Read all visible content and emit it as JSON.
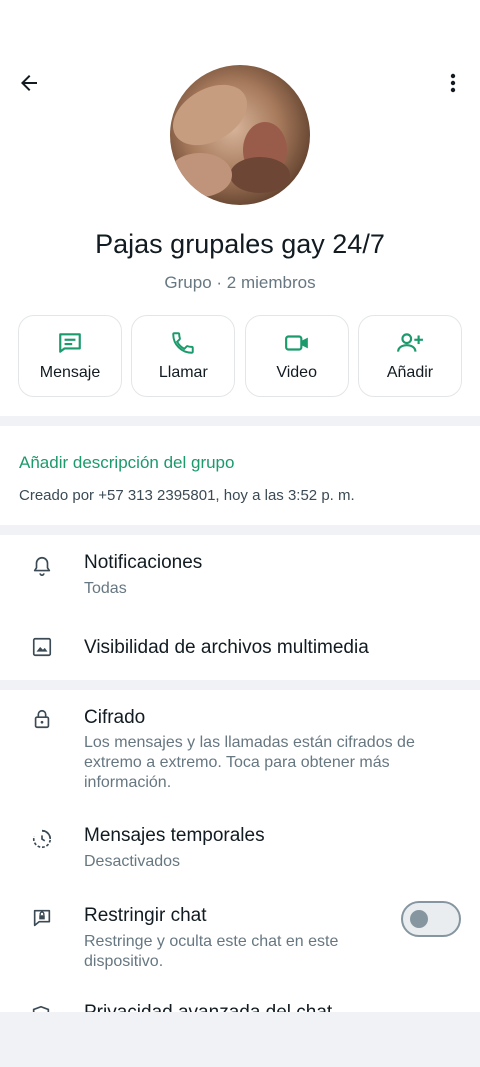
{
  "header": {
    "back_icon": "arrow-left-icon",
    "menu_icon": "more-vertical-icon"
  },
  "group": {
    "name": "Pajas grupales gay 24/7",
    "subtitle": "Grupo · 2 miembros"
  },
  "actions": [
    {
      "label": "Mensaje",
      "icon": "message-icon"
    },
    {
      "label": "Llamar",
      "icon": "phone-icon"
    },
    {
      "label": "Video",
      "icon": "video-icon"
    },
    {
      "label": "Añadir",
      "icon": "add-person-icon"
    }
  ],
  "description": {
    "add_link": "Añadir descripción del grupo",
    "created": "Creado por +57 313 2395801, hoy a las 3:52 p. m."
  },
  "settings": {
    "notifications": {
      "title": "Notificaciones",
      "subtitle": "Todas"
    },
    "media_visibility": {
      "title": "Visibilidad de archivos multimedia"
    },
    "encryption": {
      "title": "Cifrado",
      "subtitle": "Los mensajes y las llamadas están cifrados de extremo a extremo. Toca para obtener más información."
    },
    "temporary": {
      "title": "Mensajes temporales",
      "subtitle": "Desactivados"
    },
    "restrict": {
      "title": "Restringir chat",
      "subtitle": "Restringe y oculta este chat en este dispositivo.",
      "enabled": false
    },
    "privacy_cut": {
      "title": "Privacidad avanzada del chat"
    }
  },
  "colors": {
    "accent": "#1b9a6c",
    "text": "#111b21",
    "muted": "#667781"
  }
}
